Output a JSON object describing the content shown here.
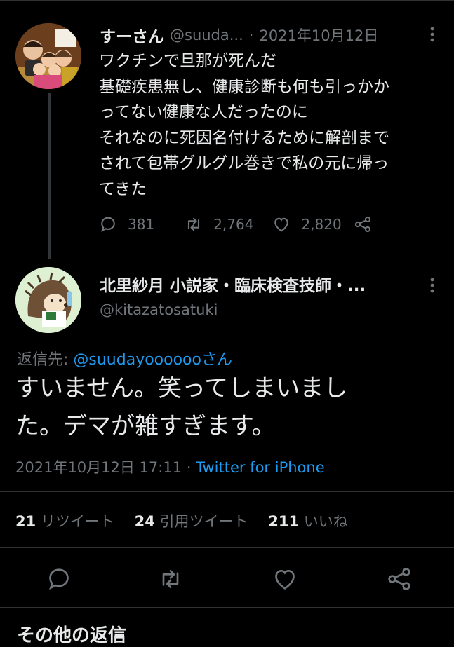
{
  "tweet": {
    "name": "すーさん",
    "handle": "@suuda...",
    "separator": "·",
    "date": "2021年10月12日",
    "text": "ワクチンで旦那が死んだ\n基礎疾患無し、健康診断も何も引っかか\nってない健康な人だったのに\nそれなのに死因名付けるために解剖まで\nされて包帯グルグル巻きで私の元に帰っ\nてきた",
    "replies": "381",
    "retweets": "2,764",
    "likes": "2,820"
  },
  "reply": {
    "name": "北里紗月 小説家・臨床検査技師・...",
    "handle": "@kitazatosatuki",
    "reply_to_label": "返信先: ",
    "reply_to_handle": "@suudayoooooo",
    "reply_to_suffix": "さん",
    "text": "すいません。笑ってしまいまし\nた。デマが雑すぎます。",
    "timestamp": "2021年10月12日 17:11",
    "separator": " · ",
    "source": "Twitter for iPhone",
    "retweet_count": "21",
    "retweet_label": "リツイート",
    "quote_count": "24",
    "quote_label": "引用ツイート",
    "like_count": "211",
    "like_label": "いいね"
  },
  "more_replies_heading": "その他の返信",
  "icons": [
    "more-vertical-icon",
    "reply-icon",
    "retweet-icon",
    "like-icon",
    "share-icon"
  ],
  "colors": {
    "background": "#000000",
    "text": "#e7e9ea",
    "muted": "#71767b",
    "link": "#1d9bf0"
  }
}
